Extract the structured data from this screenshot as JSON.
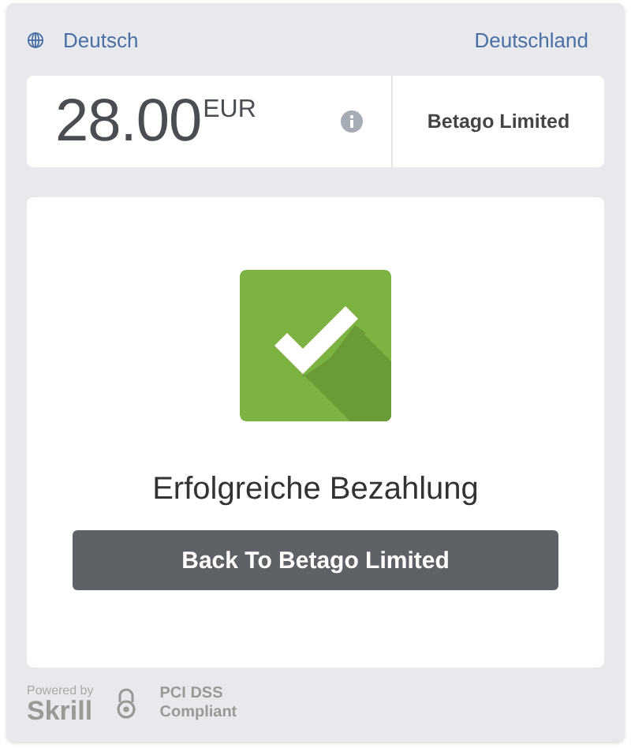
{
  "header": {
    "language": "Deutsch",
    "country": "Deutschland"
  },
  "amount": {
    "value": "28.00",
    "currency": "EUR",
    "merchant": "Betago Limited"
  },
  "result": {
    "message": "Erfolgreiche Bezahlung",
    "button": "Back To Betago Limited"
  },
  "footer": {
    "powered_by": "Powered by",
    "brand": "Skrill",
    "badge_line_1": "PCI DSS",
    "badge_line_2": "Compliant"
  }
}
